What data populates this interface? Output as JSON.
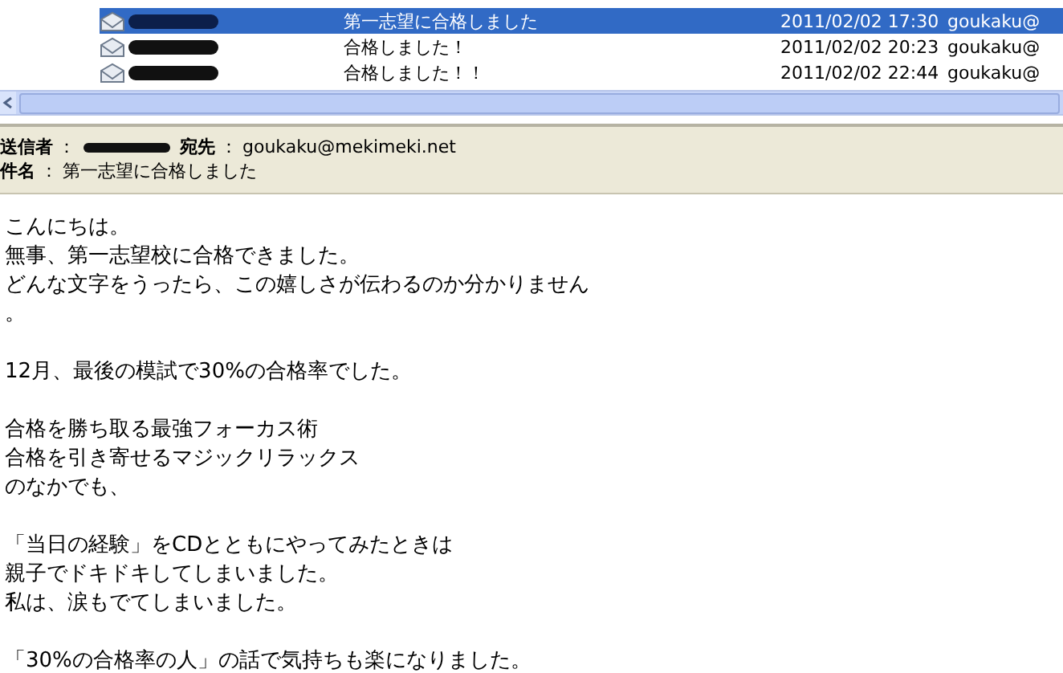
{
  "message_list": {
    "rows": [
      {
        "subject": "第一志望に合格しました",
        "date": "2011/02/02 17:30",
        "from": "goukaku@",
        "selected": true
      },
      {
        "subject": "合格しました！",
        "date": "2011/02/02 20:23",
        "from": "goukaku@",
        "selected": false
      },
      {
        "subject": "合格しました！！",
        "date": "2011/02/02 22:44",
        "from": "goukaku@",
        "selected": false
      }
    ]
  },
  "header": {
    "sender_label": "送信者",
    "to_label": "宛先",
    "to": "goukaku@mekimeki.net",
    "subject_label": "件名",
    "subject": "第一志望に合格しました",
    "separator": "："
  },
  "body": {
    "paragraphs": [
      [
        "こんにちは。",
        "無事、第一志望校に合格できました。",
        "どんな文字をうったら、この嬉しさが伝わるのか分かりません",
        "。"
      ],
      [
        "12月、最後の模試で30%の合格率でした。"
      ],
      [
        "合格を勝ち取る最強フォーカス術",
        "合格を引き寄せるマジックリラックス",
        "のなかでも、"
      ],
      [
        "「当日の経験」をCDとともにやってみたときは",
        "親子でドキドキしてしまいました。",
        "私は、涙もでてしまいました。"
      ],
      [
        "「30%の合格率の人」の話で気持ちも楽になりました。"
      ]
    ]
  }
}
